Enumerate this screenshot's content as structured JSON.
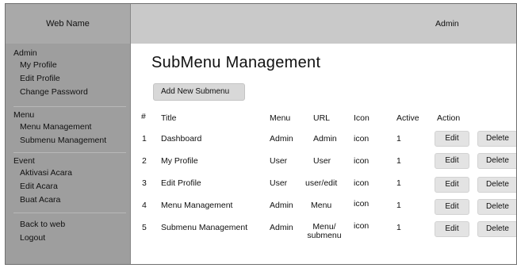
{
  "brand": "Web Name",
  "topbar": {
    "user": "Admin"
  },
  "sidebar": {
    "admin": {
      "heading": "Admin",
      "items": [
        "My Profile",
        "Edit Profile",
        "Change Password"
      ]
    },
    "menu": {
      "heading": "Menu",
      "items": [
        "Menu Management",
        "Submenu Management"
      ]
    },
    "event": {
      "heading": "Event",
      "items": [
        "Aktivasi Acara",
        "Edit Acara",
        "Buat Acara"
      ]
    },
    "footer": {
      "items": [
        "Back to web",
        "Logout"
      ]
    }
  },
  "page": {
    "title": "SubMenu Management",
    "add_button": "Add New Submenu"
  },
  "table": {
    "headers": {
      "num": "#",
      "title": "Title",
      "menu": "Menu",
      "url": "URL",
      "icon": "Icon",
      "active": "Active",
      "action": "Action"
    },
    "rows": [
      {
        "num": "1",
        "title": "Dashboard",
        "menu": "Admin",
        "url": "Admin",
        "icon": "icon",
        "active": "1",
        "edit": "Edit",
        "delete": "Delete"
      },
      {
        "num": "2",
        "title": "My Profile",
        "menu": "User",
        "url": "User",
        "icon": "icon",
        "active": "1",
        "edit": "Edit",
        "delete": "Delete"
      },
      {
        "num": "3",
        "title": "Edit Profile",
        "menu": "User",
        "url": "user/edit",
        "icon": "icon",
        "active": "1",
        "edit": "Edit",
        "delete": "Delete"
      },
      {
        "num": "4",
        "title": "Menu Management",
        "menu": "Admin",
        "url": "Menu",
        "icon": "icon",
        "active": "1",
        "edit": "Edit",
        "delete": "Delete"
      },
      {
        "num": "5",
        "title": "Submenu Management",
        "menu": "Admin",
        "url": "Menu/ submenu",
        "icon": "icon",
        "active": "1",
        "edit": "Edit",
        "delete": "Delete"
      }
    ]
  }
}
